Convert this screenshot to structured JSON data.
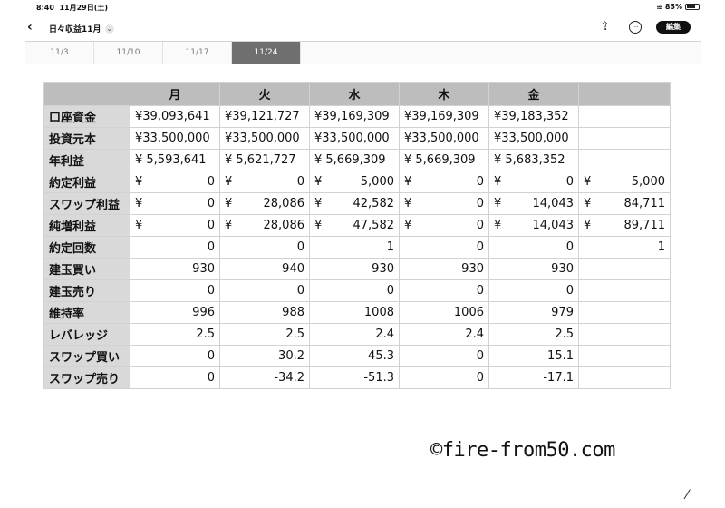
{
  "status_bar": {
    "time": "8:40",
    "date": "11月29日(土)",
    "battery": "85%"
  },
  "toolbar": {
    "back_icon": "‹",
    "title": "日々収益11月",
    "chevron": "⌄",
    "share_icon": "⇪",
    "more_icon": "···",
    "edit_label": "編集"
  },
  "tabs": [
    {
      "label": "11/3",
      "active": false
    },
    {
      "label": "11/10",
      "active": false
    },
    {
      "label": "11/17",
      "active": false
    },
    {
      "label": "11/24",
      "active": true
    }
  ],
  "table": {
    "headers": [
      "",
      "月",
      "火",
      "水",
      "木",
      "金",
      ""
    ],
    "rows": [
      {
        "label": "口座資金",
        "cells": [
          {
            "plain": "¥39,093,641"
          },
          {
            "plain": "¥39,121,727"
          },
          {
            "plain": "¥39,169,309"
          },
          {
            "plain": "¥39,169,309"
          },
          {
            "plain": "¥39,183,352"
          },
          {
            "plain": ""
          }
        ]
      },
      {
        "label": "投資元本",
        "cells": [
          {
            "plain": "¥33,500,000"
          },
          {
            "plain": "¥33,500,000"
          },
          {
            "plain": "¥33,500,000"
          },
          {
            "plain": "¥33,500,000"
          },
          {
            "plain": "¥33,500,000"
          },
          {
            "plain": ""
          }
        ]
      },
      {
        "label": "年利益",
        "cells": [
          {
            "plain": "¥ 5,593,641"
          },
          {
            "plain": "¥ 5,621,727"
          },
          {
            "plain": "¥ 5,669,309"
          },
          {
            "plain": "¥ 5,669,309"
          },
          {
            "plain": "¥ 5,683,352"
          },
          {
            "plain": ""
          }
        ]
      },
      {
        "label": "約定利益",
        "cells": [
          {
            "yen": "¥",
            "val": "0"
          },
          {
            "yen": "¥",
            "val": "0"
          },
          {
            "yen": "¥",
            "val": "5,000"
          },
          {
            "yen": "¥",
            "val": "0"
          },
          {
            "yen": "¥",
            "val": "0"
          },
          {
            "yen": "¥",
            "val": "5,000"
          }
        ]
      },
      {
        "label": "スワップ利益",
        "cells": [
          {
            "yen": "¥",
            "val": "0"
          },
          {
            "yen": "¥",
            "val": "28,086"
          },
          {
            "yen": "¥",
            "val": "42,582"
          },
          {
            "yen": "¥",
            "val": "0"
          },
          {
            "yen": "¥",
            "val": "14,043"
          },
          {
            "yen": "¥",
            "val": "84,711"
          }
        ]
      },
      {
        "label": "純増利益",
        "cells": [
          {
            "yen": "¥",
            "val": "0"
          },
          {
            "yen": "¥",
            "val": "28,086"
          },
          {
            "yen": "¥",
            "val": "47,582"
          },
          {
            "yen": "¥",
            "val": "0"
          },
          {
            "yen": "¥",
            "val": "14,043"
          },
          {
            "yen": "¥",
            "val": "89,711"
          }
        ]
      },
      {
        "label": "約定回数",
        "cells": [
          {
            "val": "0"
          },
          {
            "val": "0"
          },
          {
            "val": "1"
          },
          {
            "val": "0"
          },
          {
            "val": "0"
          },
          {
            "val": "1"
          }
        ]
      },
      {
        "label": "建玉買い",
        "cells": [
          {
            "val": "930"
          },
          {
            "val": "940"
          },
          {
            "val": "930"
          },
          {
            "val": "930"
          },
          {
            "val": "930"
          },
          {
            "val": ""
          }
        ]
      },
      {
        "label": "建玉売り",
        "cells": [
          {
            "val": "0"
          },
          {
            "val": "0"
          },
          {
            "val": "0"
          },
          {
            "val": "0"
          },
          {
            "val": "0"
          },
          {
            "val": ""
          }
        ]
      },
      {
        "label": "維持率",
        "cells": [
          {
            "val": "996"
          },
          {
            "val": "988"
          },
          {
            "val": "1008"
          },
          {
            "val": "1006"
          },
          {
            "val": "979"
          },
          {
            "val": ""
          }
        ]
      },
      {
        "label": "レバレッジ",
        "cells": [
          {
            "val": "2.5"
          },
          {
            "val": "2.5"
          },
          {
            "val": "2.4"
          },
          {
            "val": "2.4"
          },
          {
            "val": "2.5"
          },
          {
            "val": ""
          }
        ]
      },
      {
        "label": "スワップ買い",
        "cells": [
          {
            "val": "0"
          },
          {
            "val": "30.2"
          },
          {
            "val": "45.3"
          },
          {
            "val": "0"
          },
          {
            "val": "15.1"
          },
          {
            "val": ""
          }
        ]
      },
      {
        "label": "スワップ売り",
        "cells": [
          {
            "val": "0"
          },
          {
            "val": "-34.2"
          },
          {
            "val": "-51.3"
          },
          {
            "val": "0"
          },
          {
            "val": "-17.1"
          },
          {
            "val": ""
          }
        ]
      }
    ]
  },
  "watermark": "©fire-from50.com",
  "corner_mark": "⁄"
}
